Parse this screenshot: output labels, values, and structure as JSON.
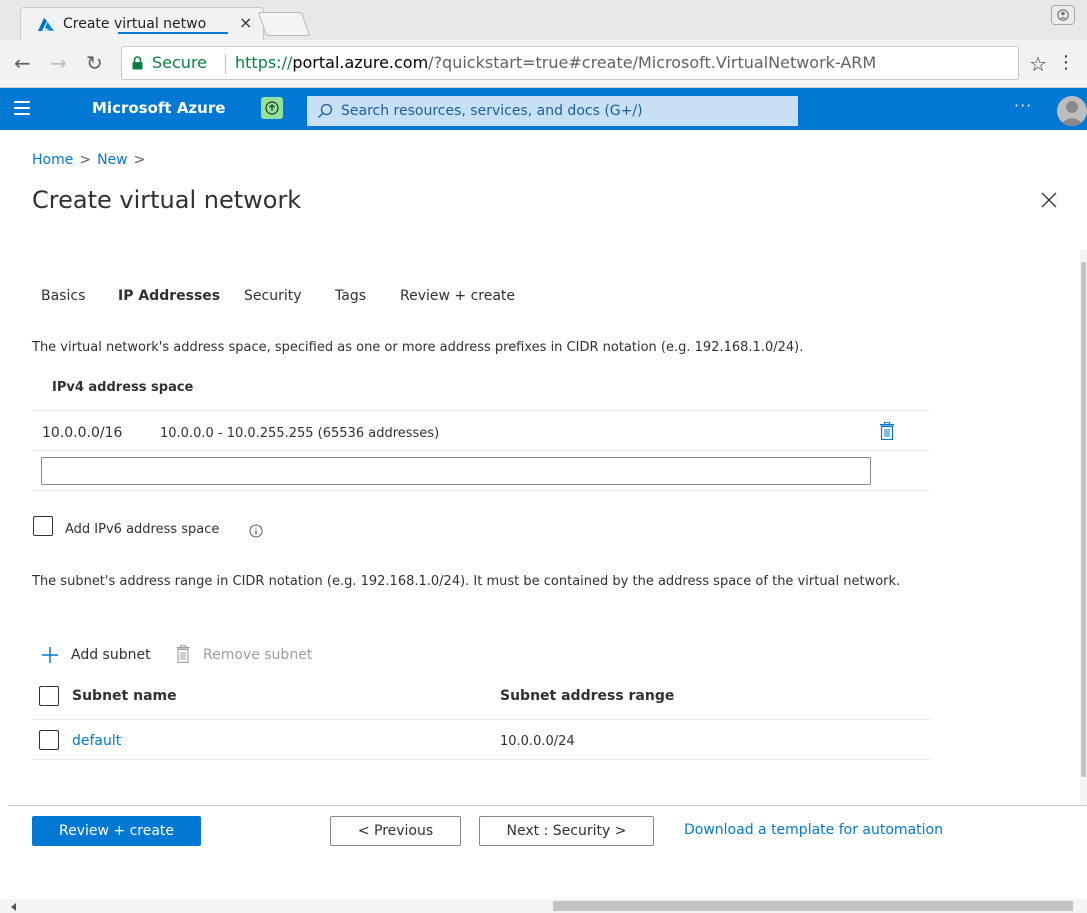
{
  "browser": {
    "tab_title": "Create virtual netwo",
    "tab_close": "×",
    "secure_label": "Secure",
    "url_protocol": "https://",
    "url_host": "portal.azure.com",
    "url_rest": "/?quickstart=true#create/Microsoft.VirtualNetwork-ARM"
  },
  "azure_header": {
    "brand": "Microsoft Azure",
    "search_placeholder": "Search resources, services, and docs (G+/)",
    "more": "···"
  },
  "breadcrumb": [
    "Home",
    "New"
  ],
  "page_title": "Create virtual network",
  "tabs": [
    {
      "label": "Basics",
      "active": false
    },
    {
      "label": "IP Addresses",
      "active": true
    },
    {
      "label": "Security",
      "active": false
    },
    {
      "label": "Tags",
      "active": false
    },
    {
      "label": "Review + create",
      "active": false
    }
  ],
  "address_space": {
    "description": "The virtual network's address space, specified as one or more address prefixes in CIDR notation (e.g. 192.168.1.0/24).",
    "header": "IPv4 address space",
    "rows": [
      {
        "prefix": "10.0.0.0/16",
        "range": "10.0.0.0 - 10.0.255.255 (65536 addresses)"
      }
    ],
    "new_value": ""
  },
  "ipv6": {
    "label": "Add IPv6 address space",
    "checked": false
  },
  "subnets": {
    "description": "The subnet's address range in CIDR notation (e.g. 192.168.1.0/24). It must be contained by the address space of the virtual network.",
    "add_label": "Add subnet",
    "remove_label": "Remove subnet",
    "columns": [
      "Subnet name",
      "Subnet address range"
    ],
    "rows": [
      {
        "name": "default",
        "range": "10.0.0.0/24"
      }
    ]
  },
  "footer": {
    "review_create": "Review + create",
    "previous": "< Previous",
    "next": "Next : Security >",
    "download": "Download a template for automation"
  },
  "colors": {
    "azure_blue": "#0078d4",
    "secure_green": "#0b8043"
  }
}
